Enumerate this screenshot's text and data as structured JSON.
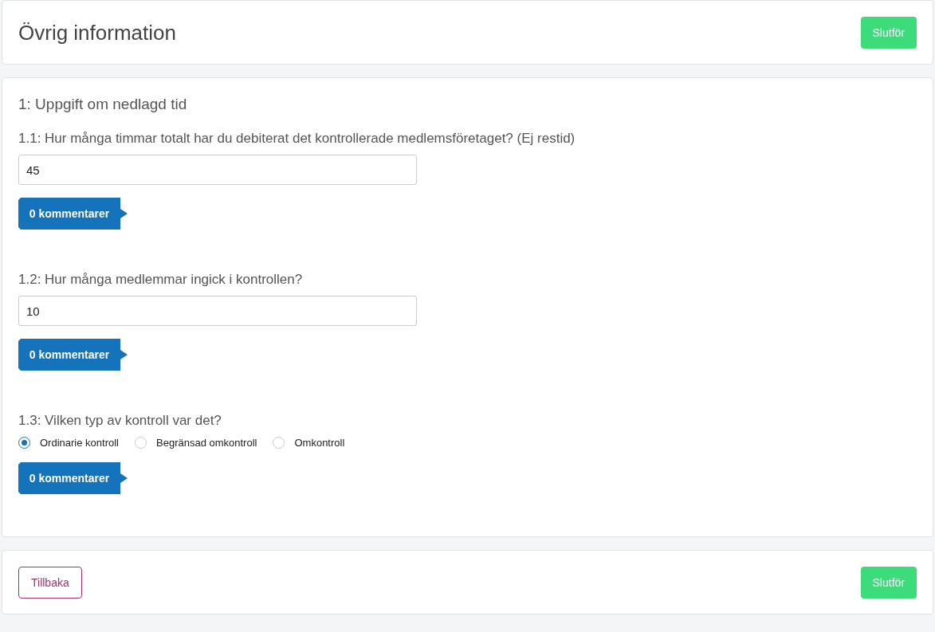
{
  "header": {
    "title": "Övrig information",
    "finish_button": "Slutför"
  },
  "section": {
    "title": "1: Uppgift om nedlagd tid",
    "questions": [
      {
        "kind": "text",
        "label": "1.1: Hur många timmar totalt har du debiterat det kontrollerade medlemsföretaget? (Ej restid)",
        "value": "45",
        "comments_button": "0 kommentarer"
      },
      {
        "kind": "text",
        "label": "1.2: Hur många medlemmar ingick i kontrollen?",
        "value": "10",
        "comments_button": "0 kommentarer"
      },
      {
        "kind": "radio",
        "label": "1.3: Vilken typ av kontroll var det?",
        "options": [
          {
            "label": "Ordinarie kontroll",
            "selected": true
          },
          {
            "label": "Begränsad omkontroll",
            "selected": false
          },
          {
            "label": "Omkontroll",
            "selected": false
          }
        ],
        "comments_button": "0 kommentarer"
      }
    ]
  },
  "footer": {
    "back_button": "Tillbaka",
    "finish_button": "Slutför"
  }
}
